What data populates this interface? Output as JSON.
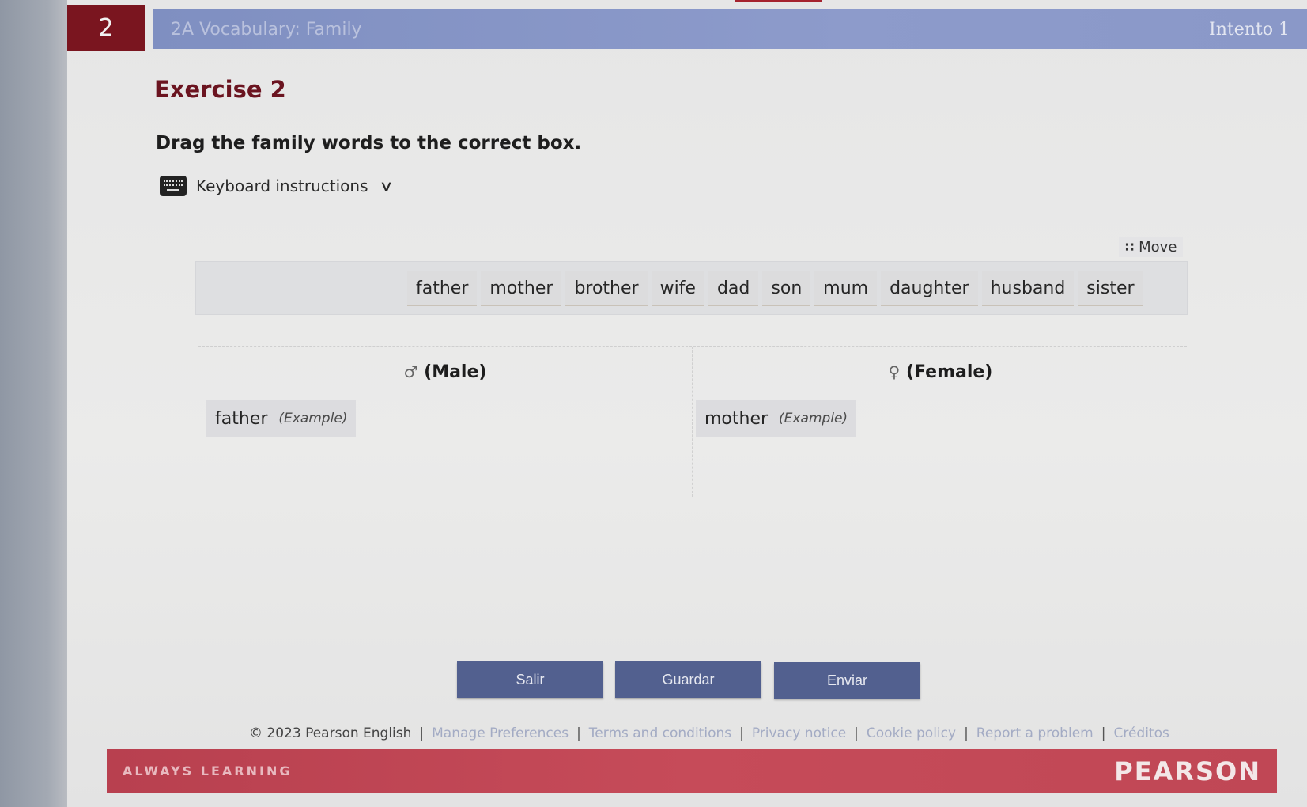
{
  "header": {
    "question_number": "2",
    "activity_title": "2A Vocabulary: Family",
    "attempt": "Intento 1"
  },
  "exercise": {
    "title": "Exercise 2",
    "instruction": "Drag the family words to the correct box.",
    "keyboard_instructions_label": "Keyboard instructions",
    "move_label": "Move"
  },
  "word_bank": [
    "father",
    "mother",
    "brother",
    "wife",
    "dad",
    "son",
    "mum",
    "daughter",
    "husband",
    "sister"
  ],
  "columns": {
    "male": {
      "symbol": "♂",
      "label": "(Male)",
      "example_word": "father",
      "example_tag": "(Example)"
    },
    "female": {
      "symbol": "♀",
      "label": "(Female)",
      "example_word": "mother",
      "example_tag": "(Example)"
    }
  },
  "buttons": {
    "exit": "Salir",
    "save": "Guardar",
    "submit": "Enviar"
  },
  "footer": {
    "copyright": "© 2023 Pearson English",
    "links": [
      "Manage Preferences",
      "Terms and conditions",
      "Privacy notice",
      "Cookie policy",
      "Report a problem",
      "Créditos"
    ]
  },
  "brand": {
    "tagline": "ALWAYS LEARNING",
    "logo": "PEARSON"
  },
  "icons": {
    "keyboard": "keyboard-icon",
    "chevron": "chevron-down-icon",
    "grip": "grip-dots-icon"
  },
  "colors": {
    "accent": "#7a151f",
    "title_bar": "#8695c6",
    "button": "#52608f",
    "brand_bar": "#c04755"
  }
}
